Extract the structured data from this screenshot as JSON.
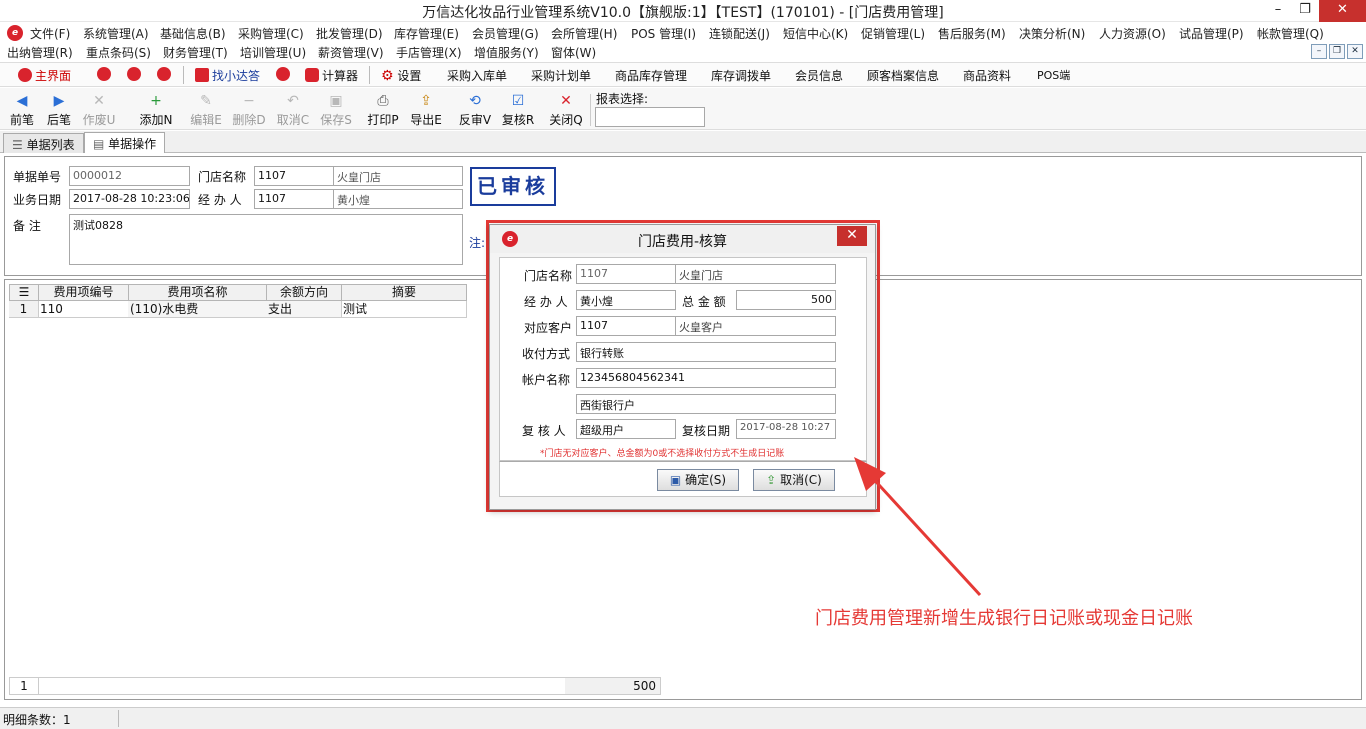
{
  "window": {
    "title": "万信达化妆品行业管理系统V10.0【旗舰版:1】【TEST】(170101) - [门店费用管理]",
    "minimize": "–",
    "restore": "❐",
    "close": "✕"
  },
  "menubar": {
    "row1": [
      "文件(F)",
      "系统管理(A)",
      "基础信息(B)",
      "采购管理(C)",
      "批发管理(D)",
      "库存管理(E)",
      "会员管理(G)",
      "会所管理(H)",
      "POS 管理(I)",
      "连锁配送(J)",
      "短信中心(K)",
      "促销管理(L)",
      "售后服务(M)",
      "决策分析(N)",
      "人力资源(O)",
      "试品管理(P)",
      "帐款管理(Q)"
    ],
    "row2": [
      "出纳管理(R)",
      "重点条码(S)",
      "财务管理(T)",
      "培训管理(U)",
      "薪资管理(V)",
      "手店管理(X)",
      "增值服务(Y)",
      "窗体(W)"
    ],
    "mdi": [
      "–",
      "❐",
      "✕"
    ]
  },
  "quickbar": {
    "items": [
      "主界面",
      "找小达答",
      "计算器",
      "设置",
      "采购入库单",
      "采购计划单",
      "商品库存管理",
      "库存调拨单",
      "会员信息",
      "顾客档案信息",
      "商品资料",
      "POS端"
    ]
  },
  "toolbar": {
    "buttons": [
      {
        "label": "前笔",
        "icon": "◀"
      },
      {
        "label": "后笔",
        "icon": "▶"
      },
      {
        "label": "作废U",
        "icon": "✕"
      },
      {
        "label": "添加N",
        "icon": "+"
      },
      {
        "label": "编辑E",
        "icon": "✎"
      },
      {
        "label": "删除D",
        "icon": "−"
      },
      {
        "label": "取消C",
        "icon": "↶"
      },
      {
        "label": "保存S",
        "icon": "▣"
      },
      {
        "label": "打印P",
        "icon": "⎙"
      },
      {
        "label": "导出E",
        "icon": "⇪"
      },
      {
        "label": "反审V",
        "icon": "⟲"
      },
      {
        "label": "复核R",
        "icon": "☑"
      },
      {
        "label": "关闭Q",
        "icon": "✕"
      }
    ],
    "report_label": "报表选择:",
    "report_value": ""
  },
  "tabs": [
    "单据列表",
    "单据操作"
  ],
  "form": {
    "doc_no_label": "单据单号",
    "doc_no": "0000012",
    "store_label": "门店名称",
    "store_code": "1107",
    "store_name": "火皇门店",
    "date_label": "业务日期",
    "date": "2017-08-28 10:23:06",
    "handler_label": "经 办 人",
    "handler_code": "1107",
    "handler_name": "黄小煌",
    "remark_label": "备    注",
    "remark": "测试0828",
    "stamp": "已审核",
    "note_label": "注:"
  },
  "grid": {
    "columns": [
      "费用项编号",
      "费用项名称",
      "余额方向",
      "摘要"
    ],
    "rows": [
      {
        "index": "1",
        "code": "110",
        "name": "(110)水电费",
        "direction": "支出",
        "summary": "测试"
      }
    ],
    "footer_count": "1",
    "footer_total": "500"
  },
  "status": {
    "detail_count": "明细条数：1"
  },
  "dialog": {
    "title": "门店费用-核算",
    "close": "✕",
    "store_label": "门店名称",
    "store_code": "1107",
    "store_name": "火皇门店",
    "handler_label": "经 办 人",
    "handler_name": "黄小煌",
    "total_label": "总 金 额",
    "total": "500",
    "customer_label": "对应客户",
    "customer_code": "1107",
    "customer_name": "火皇客户",
    "payment_label": "收付方式",
    "payment": "银行转账",
    "account_label": "帐户名称",
    "account_no": "123456804562341",
    "account_name": "西街银行户",
    "reviewer_label": "复 核 人",
    "reviewer": "超级用户",
    "review_date_label": "复核日期",
    "review_date": "2017-08-28 10:27",
    "warning": "*门店无对应客户、总金额为0或不选择收付方式不生成日记账",
    "ok_label": "确定(S)",
    "cancel_label": "取消(C)"
  },
  "annotation": {
    "text": "门店费用管理新增生成银行日记账或现金日记账",
    "color": "#e53935"
  },
  "colors": {
    "accent_red": "#d9232d",
    "stamp_blue": "#1a3c9c"
  }
}
